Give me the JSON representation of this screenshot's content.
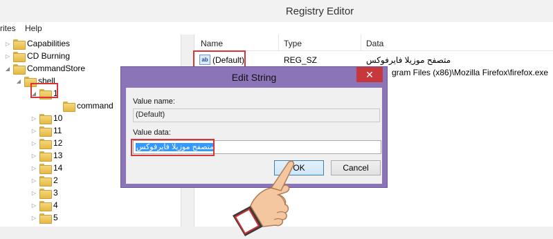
{
  "window": {
    "title": "Registry Editor"
  },
  "menu": {
    "favorites": "rites",
    "help": "Help"
  },
  "tree": [
    {
      "label": "Capabilities",
      "expander": "▷",
      "indent": 0
    },
    {
      "label": "CD Burning",
      "expander": "▷",
      "indent": 0
    },
    {
      "label": "CommandStore",
      "expander": "◢",
      "indent": 0
    },
    {
      "label": "shell",
      "expander": "◢",
      "indent": 1
    },
    {
      "label": "1",
      "expander": "◢",
      "indent": 2
    },
    {
      "label": "command",
      "expander": "",
      "indent": 3
    },
    {
      "label": "10",
      "expander": "▷",
      "indent": 2
    },
    {
      "label": "11",
      "expander": "▷",
      "indent": 2
    },
    {
      "label": "12",
      "expander": "▷",
      "indent": 2
    },
    {
      "label": "13",
      "expander": "▷",
      "indent": 2
    },
    {
      "label": "14",
      "expander": "▷",
      "indent": 2
    },
    {
      "label": "2",
      "expander": "▷",
      "indent": 2
    },
    {
      "label": "3",
      "expander": "▷",
      "indent": 2
    },
    {
      "label": "4",
      "expander": "▷",
      "indent": 2
    },
    {
      "label": "5",
      "expander": "▷",
      "indent": 2
    }
  ],
  "list": {
    "columns": {
      "name": "Name",
      "type": "Type",
      "data": "Data"
    },
    "rows": [
      {
        "icon": "ab",
        "name": "(Default)",
        "type": "REG_SZ",
        "data": "متصفح موزيلا فايرفوكس"
      },
      {
        "icon": "ab",
        "name": "",
        "type": "",
        "data": "gram Files (x86)\\Mozilla Firefox\\firefox.exe"
      }
    ]
  },
  "dialog": {
    "title": "Edit String",
    "close": "✕",
    "value_name_label": "Value name:",
    "value_name": "(Default)",
    "value_data_label": "Value data:",
    "value_data": "متصفح موزيلا فايرفوكس",
    "ok": "OK",
    "cancel": "Cancel"
  },
  "colors": {
    "highlight": "#d9343a",
    "dialog_frame": "#8b74b8",
    "close": "#c7383c",
    "selection": "#3399ff"
  },
  "icons": {
    "folder": "folder-icon",
    "string_value": "string-value-icon",
    "pointer": "pointing-hand-icon"
  }
}
